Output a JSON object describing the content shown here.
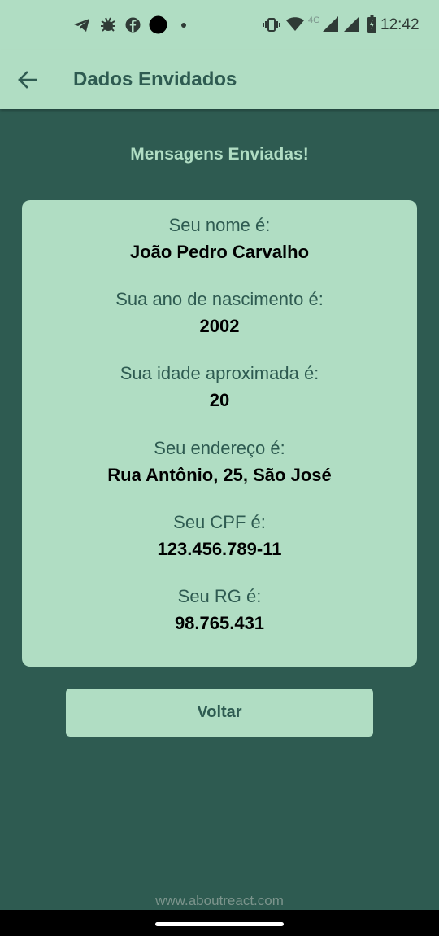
{
  "status_bar": {
    "time": "12:42",
    "network_label": "4G",
    "left_icons": [
      "telegram-icon",
      "bug-icon",
      "facebook-icon",
      "record-dot-icon",
      "small-dot-icon"
    ],
    "right_icons": [
      "vibrate-icon",
      "wifi-icon",
      "signal-icon",
      "signal-icon",
      "battery-charging-icon"
    ]
  },
  "app_bar": {
    "title": "Dados Envidados",
    "back_icon": "arrow-left-icon"
  },
  "main": {
    "heading": "Mensagens Enviadas!",
    "fields": [
      {
        "label": "Seu nome é:",
        "value": "João Pedro Carvalho"
      },
      {
        "label": "Sua ano de nascimento é:",
        "value": "2002"
      },
      {
        "label": "Sua idade aproximada é:",
        "value": "20"
      },
      {
        "label": "Seu endereço é:",
        "value": "Rua Antônio, 25, São José"
      },
      {
        "label": "Seu CPF é:",
        "value": "123.456.789-11"
      },
      {
        "label": "Seu RG é:",
        "value": "98.765.431"
      }
    ],
    "button_label": "Voltar"
  },
  "footer": {
    "text": "www.aboutreact.com"
  },
  "colors": {
    "background": "#2e5b51",
    "accent": "#b0ddc3",
    "muted_text": "#7c948c"
  }
}
